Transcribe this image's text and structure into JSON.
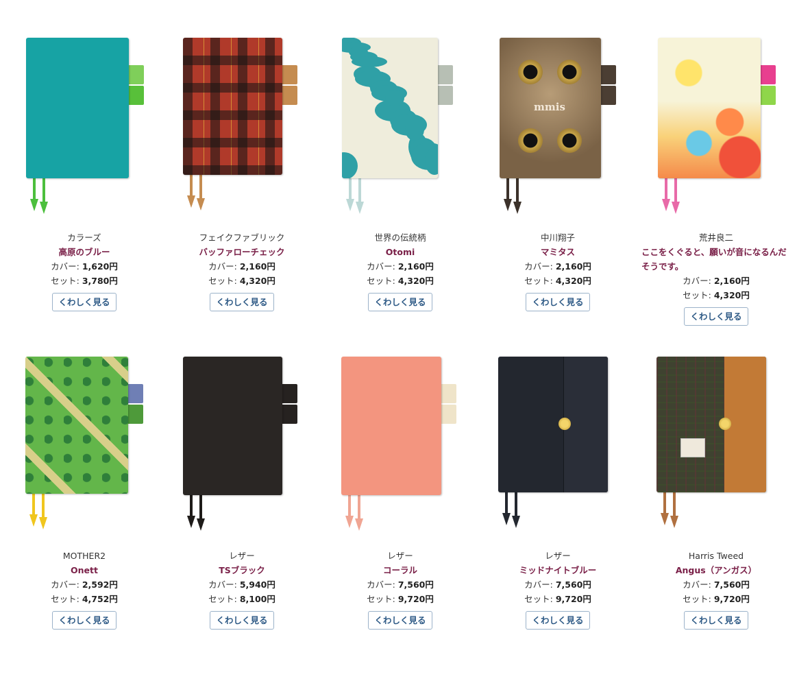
{
  "accent_colors": {
    "name_text": "#7a2048",
    "button_text": "#2e5a86",
    "button_border": "#9bb2c9"
  },
  "price_labels": {
    "cover": "カバー:",
    "set": "セット:"
  },
  "products": [
    {
      "brand": "カラーズ",
      "name": "高原のブルー",
      "cover_price": "1,620円",
      "set_price": "3,780円",
      "button": "くわしく見る",
      "cover_color": "#17a3a4",
      "tab_colors": [
        "#7fcf5a",
        "#58c03a"
      ],
      "ribbon_color": "#4cbf3d",
      "pattern": "solid"
    },
    {
      "brand": "フェイクファブリック",
      "name": "バッファローチェック",
      "cover_price": "2,160円",
      "set_price": "4,320円",
      "button": "くわしく見る",
      "cover_color": "#b03a2a",
      "tab_colors": [
        "#c58c50",
        "#c58c50"
      ],
      "ribbon_color": "#c58c50",
      "pattern": "plaid"
    },
    {
      "brand": "世界の伝統柄",
      "name": "Otomi",
      "cover_price": "2,160円",
      "set_price": "4,320円",
      "button": "くわしく見る",
      "cover_color": "#2fa0a6",
      "tab_colors": [
        "#b7bfb4",
        "#b7bfb4"
      ],
      "ribbon_color": "#bcd8d6",
      "pattern": "otomi"
    },
    {
      "brand": "中川翔子",
      "name": "マミタス",
      "cover_price": "2,160円",
      "set_price": "4,320円",
      "button": "くわしく見る",
      "cover_color": "#8a7458",
      "tab_colors": [
        "#4b3e33",
        "#4b3e33"
      ],
      "ribbon_color": "#3c322b",
      "pattern": "cat",
      "cover_text": "mmis"
    },
    {
      "brand": "荒井良二",
      "name": "ここをくぐると、願いが音になるんだそうです。",
      "cover_price": "2,160円",
      "set_price": "4,320円",
      "button": "くわしく見る",
      "cover_color": "#f3efd0",
      "tab_colors": [
        "#e83f8f",
        "#8fd64a"
      ],
      "ribbon_color": "#e86aa8",
      "pattern": "art"
    },
    {
      "brand": "MOTHER2",
      "name": "Onett",
      "cover_price": "2,592円",
      "set_price": "4,752円",
      "button": "くわしく見る",
      "cover_color": "#63b64a",
      "tab_colors": [
        "#6f7fb5",
        "#4e9a3a"
      ],
      "ribbon_color": "#f0c61e",
      "pattern": "map"
    },
    {
      "brand": "レザー",
      "name": "TSブラック",
      "cover_price": "5,940円",
      "set_price": "8,100円",
      "button": "くわしく見る",
      "cover_color": "#2a2624",
      "tab_colors": [
        "#262220",
        "#262220"
      ],
      "ribbon_color": "#1e1b19",
      "pattern": "solid"
    },
    {
      "brand": "レザー",
      "name": "コーラル",
      "cover_price": "7,560円",
      "set_price": "9,720円",
      "button": "くわしく見る",
      "cover_color": "#f3957f",
      "tab_colors": [
        "#efe4c9",
        "#efe4c9"
      ],
      "ribbon_color": "#f0a593",
      "pattern": "solid"
    },
    {
      "brand": "レザー",
      "name": "ミッドナイトブルー",
      "cover_price": "7,560円",
      "set_price": "9,720円",
      "button": "くわしく見る",
      "cover_color": "#23272f",
      "tab_colors": [
        "#23272f",
        "#23272f"
      ],
      "ribbon_color": "#23272f",
      "pattern": "flap"
    },
    {
      "brand": "Harris Tweed",
      "name": "Angus（アンガス）",
      "cover_price": "7,560円",
      "set_price": "9,720円",
      "button": "くわしく見る",
      "cover_color": "#3f4230",
      "tab_colors": [
        "#c27a36",
        "#c27a36"
      ],
      "ribbon_color": "#b07040",
      "pattern": "tweed"
    }
  ]
}
